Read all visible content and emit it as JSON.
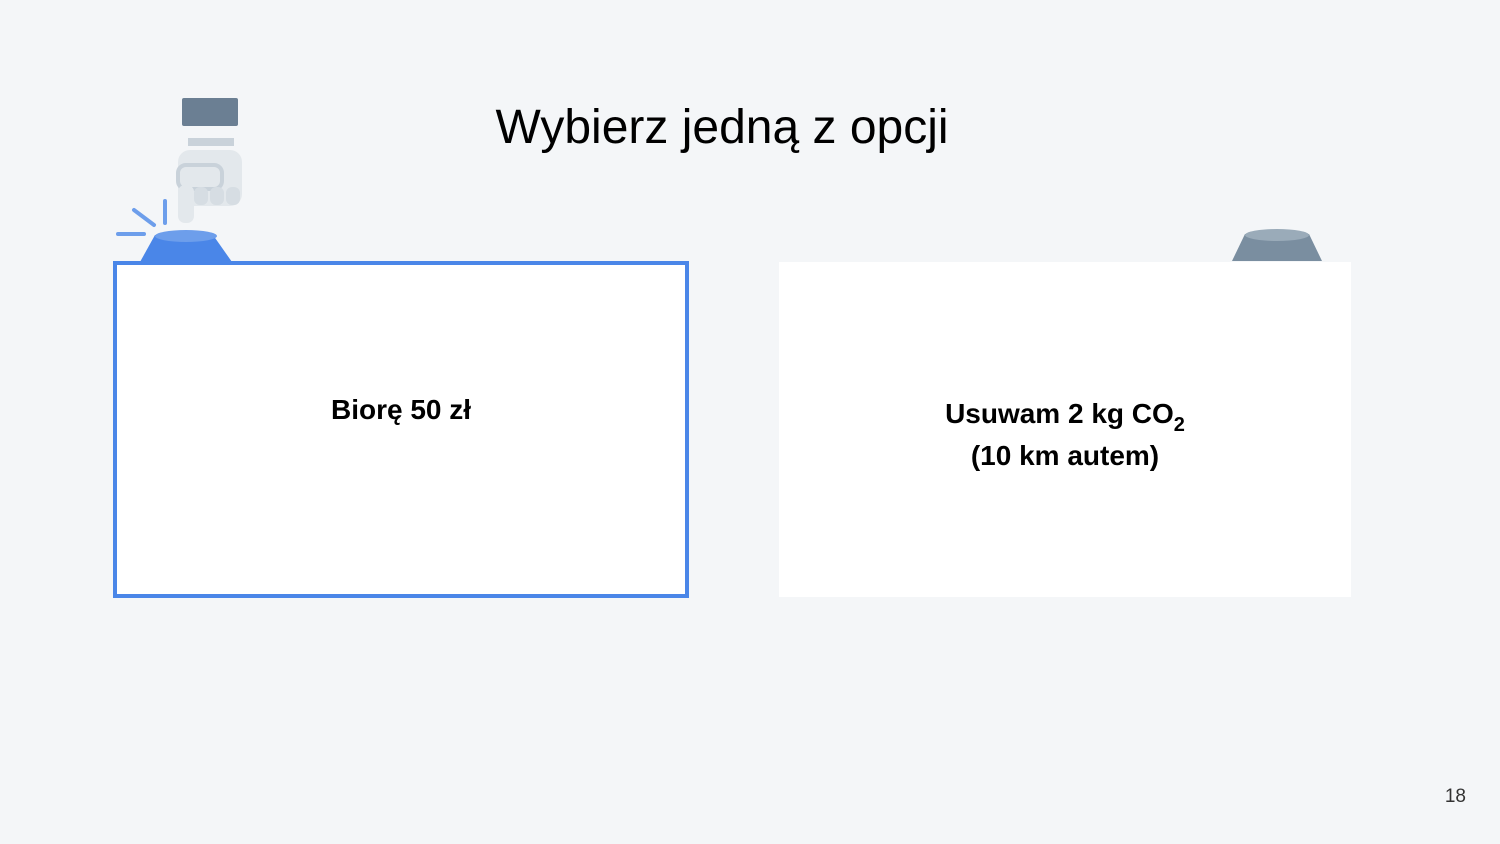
{
  "slide": {
    "title": "Wybierz jedną z opcji",
    "page_number": "18"
  },
  "options": {
    "left": {
      "label": "Biorę 50 zł",
      "selected": true
    },
    "right": {
      "line1_main": "Usuwam 2 kg CO",
      "line1_sub": "2",
      "line2": "(10 km autem)",
      "selected": false
    }
  },
  "colors": {
    "background": "#f4f6f8",
    "accent": "#4a86e8",
    "button_inactive": "#7a8ea0"
  },
  "icons": {
    "left": "pressed-button-with-hand-icon",
    "right": "unpressed-button-icon"
  }
}
